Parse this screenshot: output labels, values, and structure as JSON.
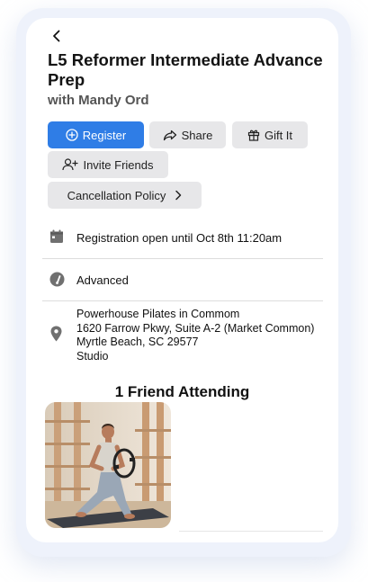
{
  "event": {
    "title": "L5 Reformer Intermediate Advance Prep",
    "instructor": "with Mandy Ord"
  },
  "buttons": {
    "register": "Register",
    "share": "Share",
    "gift": "Gift It",
    "invite": "Invite Friends",
    "cancellation": "Cancellation Policy"
  },
  "details": {
    "registration": "Registration open until Oct 8th 11:20am",
    "level": "Advanced",
    "location": {
      "name": "Powerhouse Pilates in Commom",
      "street": "1620 Farrow Pkwy, Suite A-2 (Market Common)",
      "city": "Myrtle Beach, SC 29577",
      "room": "Studio"
    }
  },
  "friends": {
    "heading": "1 Friend Attending"
  },
  "icons": {
    "back": "chevron-left-icon",
    "register": "plus-circle-icon",
    "share": "share-arrow-icon",
    "gift": "gift-icon",
    "invite": "add-user-icon",
    "cancellation": "chevron-right-icon",
    "calendar": "calendar-icon",
    "level": "gauge-icon",
    "location": "map-pin-icon"
  },
  "colors": {
    "primary": "#2f7de6",
    "button_bg": "#e7e7e9",
    "frame_bg": "#eef2fb"
  }
}
